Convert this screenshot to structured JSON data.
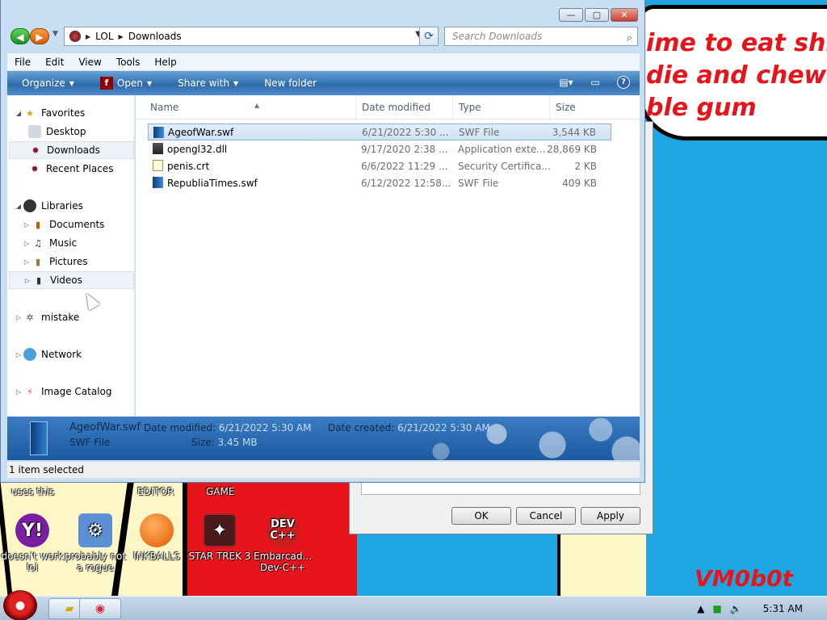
{
  "wallpaper": {
    "speech_lines": "ime to eat shit\ndie and chew\nble gum",
    "signature": "VM0b0t"
  },
  "desktop_icons": [
    {
      "label": "doesn't work lol",
      "top_label": "uses this",
      "icon": "yahoo-messenger-icon",
      "color": "#7a1fa2"
    },
    {
      "label": "probably not a rogue",
      "top_label": "",
      "icon": "system-gears-icon",
      "color": "#5b8fd6"
    },
    {
      "label": "INKBALLS",
      "top_label": "EDITOR",
      "icon": "inkball-icon",
      "color": "#f07820"
    },
    {
      "label": "STAR TREK 3",
      "top_label": "GAME",
      "icon": "star-trek-icon",
      "color": "#b0202a"
    },
    {
      "label": "Embarcad... Dev-C++",
      "top_label": "",
      "icon": "dev-cpp-icon",
      "color": "#c81e1e"
    }
  ],
  "dev_icon_text": "DEV C++",
  "properties": {
    "ok": "OK",
    "cancel": "Cancel",
    "apply": "Apply"
  },
  "window": {
    "caption": {
      "minimize": "—",
      "maximize": "▢",
      "close": "✕"
    },
    "address": {
      "root": "LOL",
      "current": "Downloads"
    },
    "search_placeholder": "Search Downloads",
    "menu": [
      "File",
      "Edit",
      "View",
      "Tools",
      "Help"
    ],
    "commands": {
      "organize": "Organize",
      "open": "Open",
      "share": "Share with",
      "new_folder": "New folder"
    },
    "nav_tree": [
      {
        "label": "Favorites",
        "icon": "star-icon",
        "arrow": "◢",
        "level": 0,
        "selected": false
      },
      {
        "label": "Desktop",
        "icon": "desktop-icon",
        "arrow": "",
        "level": 1,
        "selected": false
      },
      {
        "label": "Downloads",
        "icon": "downloads-icon",
        "arrow": "",
        "level": 1,
        "selected": true
      },
      {
        "label": "Recent Places",
        "icon": "recent-places-icon",
        "arrow": "",
        "level": 1,
        "selected": false
      },
      {
        "label": "Libraries",
        "icon": "libraries-icon",
        "arrow": "◢",
        "level": 0,
        "selected": false
      },
      {
        "label": "Documents",
        "icon": "documents-icon",
        "arrow": "▷",
        "level": 1,
        "selected": false
      },
      {
        "label": "Music",
        "icon": "music-icon",
        "arrow": "▷",
        "level": 1,
        "selected": false
      },
      {
        "label": "Pictures",
        "icon": "pictures-icon",
        "arrow": "▷",
        "level": 1,
        "selected": false
      },
      {
        "label": "Videos",
        "icon": "videos-icon",
        "arrow": "▷",
        "level": 1,
        "selected": true
      },
      {
        "label": "mistake",
        "icon": "homegroup-icon",
        "arrow": "▷",
        "level": 0,
        "selected": false
      },
      {
        "label": "Network",
        "icon": "network-icon",
        "arrow": "▷",
        "level": 0,
        "selected": false
      },
      {
        "label": "Image Catalog",
        "icon": "image-catalog-icon",
        "arrow": "▷",
        "level": 0,
        "selected": false
      }
    ],
    "columns": {
      "name": "Name",
      "date": "Date modified",
      "type": "Type",
      "size": "Size"
    },
    "files": [
      {
        "name": "AgeofWar.swf",
        "date": "6/21/2022 5:30 ...",
        "type": "SWF File",
        "size": "3,544 KB",
        "icon": "swf-file-icon",
        "selected": true
      },
      {
        "name": "opengl32.dll",
        "date": "9/17/2020 2:38 ...",
        "type": "Application exte...",
        "size": "28,869 KB",
        "icon": "dll-file-icon",
        "selected": false
      },
      {
        "name": "penis.crt",
        "date": "6/6/2022 11:29 ...",
        "type": "Security Certifica...",
        "size": "2 KB",
        "icon": "certificate-file-icon",
        "selected": false
      },
      {
        "name": "RepubliaTimes.swf",
        "date": "6/12/2022 12:58...",
        "type": "SWF File",
        "size": "409 KB",
        "icon": "swf-file-icon",
        "selected": false
      }
    ],
    "details": {
      "name": "AgeofWar.swf",
      "type": "SWF File",
      "modified_label": "Date modified:",
      "modified": "6/21/2022 5:30 AM",
      "created_label": "Date created:",
      "created": "6/21/2022 5:30 AM",
      "size_label": "Size:",
      "size": "3.45 MB"
    },
    "status": "1 item selected"
  },
  "taskbar": {
    "clock": "5:31 AM"
  }
}
